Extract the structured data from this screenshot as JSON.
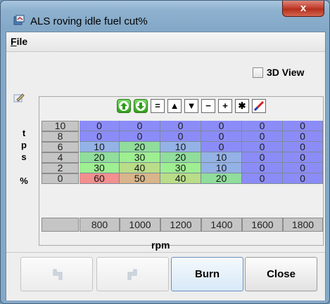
{
  "window": {
    "title": "ALS roving idle fuel cut%",
    "close_glyph": "x"
  },
  "menu": {
    "items": [
      "File"
    ]
  },
  "view3d": {
    "label": "3D View",
    "checked": false
  },
  "table": {
    "y_axis_label": [
      "t",
      "p",
      "s",
      "",
      "%"
    ],
    "x_axis_label": "rpm",
    "y_values": [
      "10",
      "8",
      "6",
      "4",
      "2",
      "0"
    ],
    "x_values": [
      "800",
      "1000",
      "1200",
      "1400",
      "1600",
      "1800"
    ],
    "rows": [
      [
        "0",
        "0",
        "0",
        "0",
        "0",
        "0"
      ],
      [
        "0",
        "0",
        "0",
        "0",
        "0",
        "0"
      ],
      [
        "10",
        "20",
        "10",
        "0",
        "0",
        "0"
      ],
      [
        "20",
        "30",
        "20",
        "10",
        "0",
        "0"
      ],
      [
        "30",
        "40",
        "30",
        "10",
        "0",
        "0"
      ],
      [
        "60",
        "50",
        "40",
        "20",
        "0",
        "0"
      ]
    ],
    "toolbar": {
      "buttons": [
        {
          "name": "increase-icon",
          "glyph": ""
        },
        {
          "name": "decrease-icon",
          "glyph": ""
        },
        {
          "name": "set-equal-button",
          "glyph": "="
        },
        {
          "name": "increment-up-button",
          "glyph": "▲"
        },
        {
          "name": "increment-down-button",
          "glyph": "▼"
        },
        {
          "name": "subtract-button",
          "glyph": "−"
        },
        {
          "name": "add-button",
          "glyph": "+"
        },
        {
          "name": "multiply-button",
          "glyph": "✱"
        },
        {
          "name": "interpolate-button",
          "glyph": ""
        }
      ]
    },
    "colors": {
      "v0": "#8c8cf8",
      "v10": "#94b2e6",
      "v20": "#90dd9c",
      "v30": "#9eee92",
      "v40": "#b9dd88",
      "v50": "#d8b58a",
      "v60": "#f28f8f"
    }
  },
  "buttons": {
    "undo": "",
    "redo": "",
    "burn": "Burn",
    "close": "Close"
  }
}
